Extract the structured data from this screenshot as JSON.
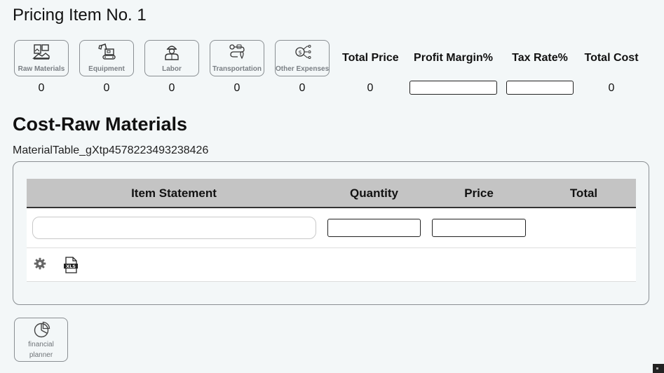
{
  "page": {
    "title": "Pricing Item No. 1"
  },
  "categories": [
    {
      "label": "Raw Materials",
      "icon": "raw-materials-icon",
      "value": "0"
    },
    {
      "label": "Equipment",
      "icon": "excavator-icon",
      "value": "0"
    },
    {
      "label": "Labor",
      "icon": "worker-icon",
      "value": "0"
    },
    {
      "label": "Transportation",
      "icon": "route-icon",
      "value": "0"
    },
    {
      "label": "Other Expenses",
      "icon": "money-network-icon",
      "value": "0"
    }
  ],
  "summary": {
    "total_price_label": "Total Price",
    "total_price_value": "0",
    "profit_margin_label": "Profit Margin%",
    "profit_margin_value": "",
    "tax_rate_label": "Tax Rate%",
    "tax_rate_value": "",
    "total_cost_label": "Total Cost",
    "total_cost_value": "0"
  },
  "section": {
    "title": "Cost-Raw Materials",
    "table_id": "MaterialTable_gXtp4578223493238426"
  },
  "table": {
    "columns": [
      "Item Statement",
      "Quantity",
      "Price",
      "Total"
    ],
    "row": {
      "statement": "",
      "quantity": "",
      "price": "",
      "total": ""
    },
    "footer_icons": [
      "gear-icon",
      "xls-file-icon"
    ]
  },
  "planner": {
    "label_line1": "financial",
    "label_line2": "planner",
    "icon": "pie-chart-icon"
  },
  "colors": {
    "background": "#f3f7f8",
    "header_bg": "#c4c4c4",
    "border": "#8a8f93",
    "label_gray": "#7a7f84"
  }
}
